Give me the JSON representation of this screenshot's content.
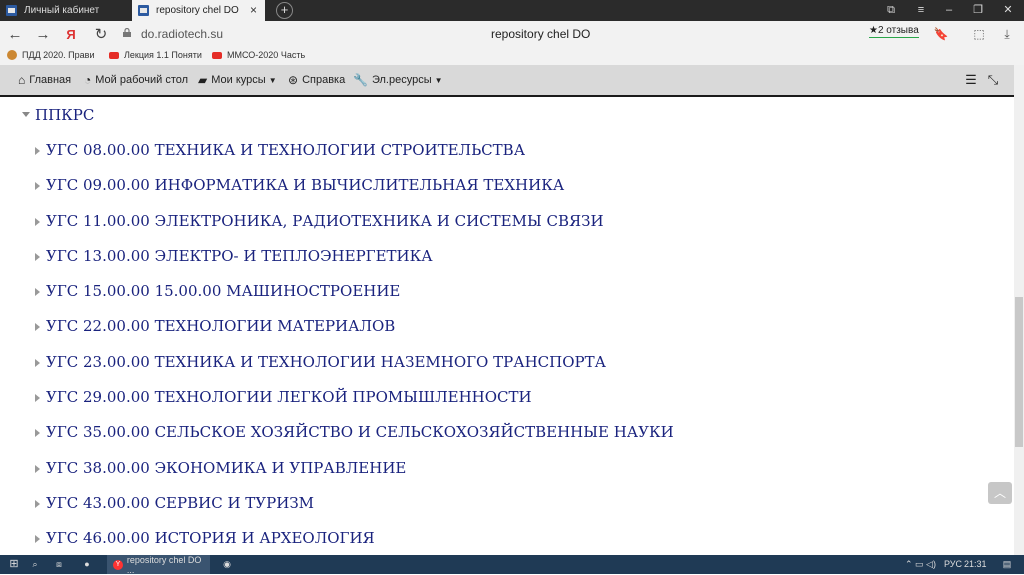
{
  "tabs": [
    {
      "label": "Личный кабинет"
    },
    {
      "label": "repository chel DO",
      "active": true
    }
  ],
  "address": {
    "domain": "do.radiotech.su",
    "page_title": "repository chel DO",
    "reviews": "★2 отзыва"
  },
  "bookmarks": [
    {
      "label": "ПДД 2020. Прави",
      "icon": "road-sign-icon"
    },
    {
      "label": "Лекция 1.1 Поняти",
      "icon": "youtube-icon"
    },
    {
      "label": "ММСО-2020 Часть",
      "icon": "youtube-icon"
    }
  ],
  "nav": {
    "home": "Главная",
    "dashboard": "Мой рабочий стол",
    "courses": "Мои курсы",
    "help": "Справка",
    "resources": "Эл.ресурсы"
  },
  "root_category": "ППКРС",
  "categories": [
    "УГС 08.00.00 ТЕХНИКА И ТЕХНОЛОГИИ СТРОИТЕЛЬСТВА",
    "УГС 09.00.00 ИНФОРМАТИКА И ВЫЧИСЛИТЕЛЬНАЯ ТЕХНИКА",
    "УГС 11.00.00 ЭЛЕКТРОНИКА, РАДИОТЕХНИКА И СИСТЕМЫ СВЯЗИ",
    "УГС 13.00.00 ЭЛЕКТРО- И ТЕПЛОЭНЕРГЕТИКА",
    "УГС 15.00.00 15.00.00 МАШИНОСТРОЕНИЕ",
    "УГС 22.00.00 ТЕХНОЛОГИИ МАТЕРИАЛОВ",
    "УГС 23.00.00 ТЕХНИКА И ТЕХНОЛОГИИ НАЗЕМНОГО ТРАНСПОРТА",
    "УГС 29.00.00 ТЕХНОЛОГИИ ЛЕГКОЙ ПРОМЫШЛЕННОСТИ",
    "УГС 35.00.00 СЕЛЬСКОЕ ХОЗЯЙСТВО И СЕЛЬСКОХОЗЯЙСТВЕННЫЕ НАУКИ",
    "УГС 38.00.00 ЭКОНОМИКА И УПРАВЛЕНИЕ",
    "УГС 43.00.00 СЕРВИС И ТУРИЗМ",
    "УГС 46.00.00 ИСТОРИЯ И АРХЕОЛОГИЯ"
  ],
  "taskbar": {
    "app_label": "repository chel DO ...",
    "lang": "РУС",
    "time": "21:31"
  },
  "colors": {
    "link": "#1a237e",
    "nav_bg": "#d9d9d9",
    "taskbar": "#1f3a55"
  }
}
